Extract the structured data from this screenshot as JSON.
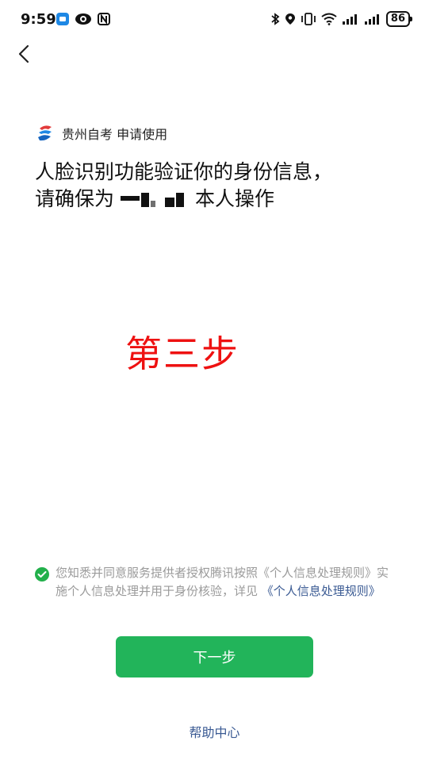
{
  "status_bar": {
    "time": "9:59",
    "battery": "86"
  },
  "requester": {
    "app_name": "贵州自考",
    "action": "申请使用"
  },
  "title": {
    "line1": "人脸识别功能验证你的身份信息，",
    "line2_prefix": "请确保为",
    "line2_suffix": "本人操作"
  },
  "annotation": {
    "text": "第三步",
    "color": "#ee1111"
  },
  "consent": {
    "checked": true,
    "text_before": "您知悉并同意服务提供者授权腾讯按照《个人信息处理规则》实施个人信息处理并用于身份核验，详见",
    "link": "《个人信息处理规则》"
  },
  "next_button": {
    "label": "下一步",
    "color": "#22b45a"
  },
  "help": {
    "label": "帮助中心"
  },
  "icons": {
    "back": "chevron-left-icon",
    "app_logo": "app-logo-icon",
    "check": "check-circle-icon"
  }
}
